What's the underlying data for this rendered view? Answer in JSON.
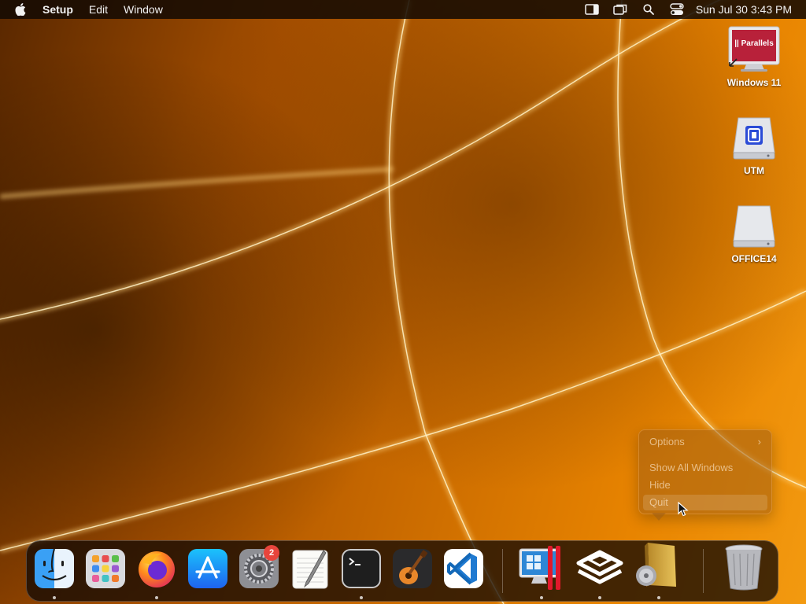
{
  "menubar": {
    "app_name": "Setup",
    "menus": [
      "Edit",
      "Window"
    ],
    "clock": "Sun Jul 30  3:43 PM",
    "status_icons": [
      "sidebar-icon",
      "screen-mirroring-icon",
      "search-icon",
      "control-center-icon"
    ]
  },
  "desktop_icons": [
    {
      "label": "Windows 11",
      "icon": "parallels-vm-icon",
      "parallels_text": "|| Parallels"
    },
    {
      "label": "UTM",
      "icon": "utm-disk-icon"
    },
    {
      "label": "OFFICE14",
      "icon": "disk-icon"
    }
  ],
  "context_menu": {
    "items": [
      "Options",
      "Show All Windows",
      "Hide",
      "Quit"
    ],
    "highlighted": "Quit"
  },
  "dock": {
    "apps": [
      {
        "name": "Finder",
        "icon": "finder-icon",
        "running": true
      },
      {
        "name": "Launchpad",
        "icon": "launchpad-icon",
        "running": false
      },
      {
        "name": "Firefox",
        "icon": "firefox-icon",
        "running": true
      },
      {
        "name": "App Store",
        "icon": "app-store-icon",
        "running": false
      },
      {
        "name": "System Settings",
        "icon": "system-settings-icon",
        "running": false,
        "badge": "2"
      },
      {
        "name": "TextEdit",
        "icon": "textedit-icon",
        "running": false
      },
      {
        "name": "Terminal",
        "icon": "terminal-icon",
        "running": true
      },
      {
        "name": "GarageBand",
        "icon": "garageband-icon",
        "running": false
      },
      {
        "name": "Visual Studio Code",
        "icon": "vscode-icon",
        "running": false
      },
      {
        "name": "Parallels Desktop",
        "icon": "parallels-icon",
        "running": true
      },
      {
        "name": "Setup Assistant",
        "icon": "setup-layers-icon",
        "running": true
      },
      {
        "name": "Office Installer",
        "icon": "installer-icon",
        "running": true
      },
      {
        "name": "Trash",
        "icon": "trash-icon",
        "running": false
      }
    ]
  },
  "colors": {
    "accent_red": "#e8453c",
    "wallpaper_orange": "#e88400"
  }
}
